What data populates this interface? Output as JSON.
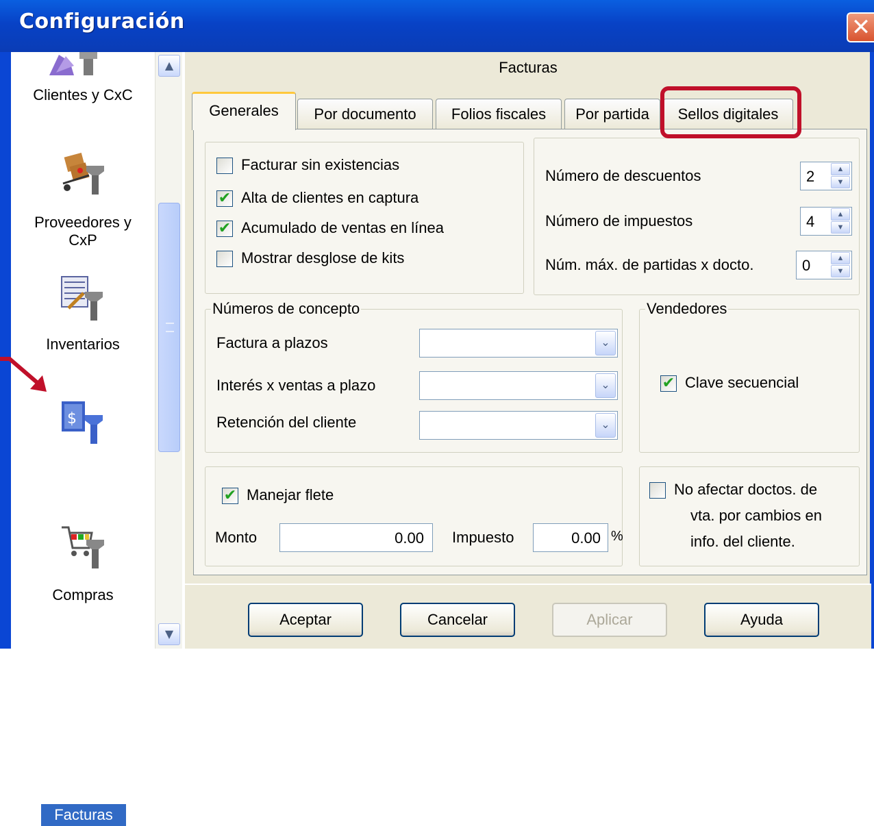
{
  "window": {
    "title": "Configuración",
    "close_glyph": "✕"
  },
  "nav": {
    "items": [
      {
        "label": "Clientes y CxC",
        "icon": "clients-config-icon"
      },
      {
        "label": "Proveedores y CxP",
        "line1": "Proveedores y",
        "line2": "CxP",
        "icon": "suppliers-config-icon"
      },
      {
        "label": "Inventarios",
        "icon": "inventory-config-icon"
      },
      {
        "label": "Facturas",
        "icon": "invoices-config-icon",
        "selected": true
      },
      {
        "label": "Compras",
        "icon": "purchases-config-icon"
      }
    ]
  },
  "page": {
    "heading": "Facturas",
    "tabs": [
      {
        "label": "Generales",
        "active": true
      },
      {
        "label": "Por documento"
      },
      {
        "label": "Folios fiscales"
      },
      {
        "label": "Por partida"
      },
      {
        "label": "Sellos digitales",
        "highlighted": true
      }
    ]
  },
  "general_options": {
    "checkboxes": [
      {
        "label": "Facturar sin existencias",
        "checked": false
      },
      {
        "label": "Alta de clientes en captura",
        "checked": true
      },
      {
        "label": "Acumulado de ventas en línea",
        "checked": true
      },
      {
        "label": "Mostrar desglose de kits",
        "checked": false
      }
    ]
  },
  "counts": {
    "descuentos_label": "Número de descuentos",
    "descuentos_value": "2",
    "impuestos_label": "Número de impuestos",
    "impuestos_value": "4",
    "max_partidas_label": "Núm. máx. de partidas x docto.",
    "max_partidas_value": "0"
  },
  "concepts": {
    "title": "Números de concepto",
    "fields": [
      {
        "label": "Factura a plazos",
        "value": ""
      },
      {
        "label": "Interés x ventas a plazo",
        "value": ""
      },
      {
        "label": "Retención del cliente",
        "value": ""
      }
    ]
  },
  "vendedores": {
    "title": "Vendedores",
    "checkbox_label": "Clave secuencial",
    "checked": true
  },
  "flete": {
    "checkbox_label": "Manejar flete",
    "checked": true,
    "monto_label": "Monto",
    "monto_value": "0.00",
    "impuesto_label": "Impuesto",
    "impuesto_value": "0.00",
    "percent": "%"
  },
  "no_afectar": {
    "line1": "No afectar doctos. de",
    "line2": "vta. por cambios en",
    "line3": "info. del cliente.",
    "checked": false
  },
  "buttons": {
    "accept": "Aceptar",
    "cancel": "Cancelar",
    "apply": "Aplicar",
    "help": "Ayuda"
  },
  "colors": {
    "title_bar": "#0842c6",
    "selection": "#316ac5",
    "highlight": "#c0102a",
    "check": "#21a121"
  }
}
